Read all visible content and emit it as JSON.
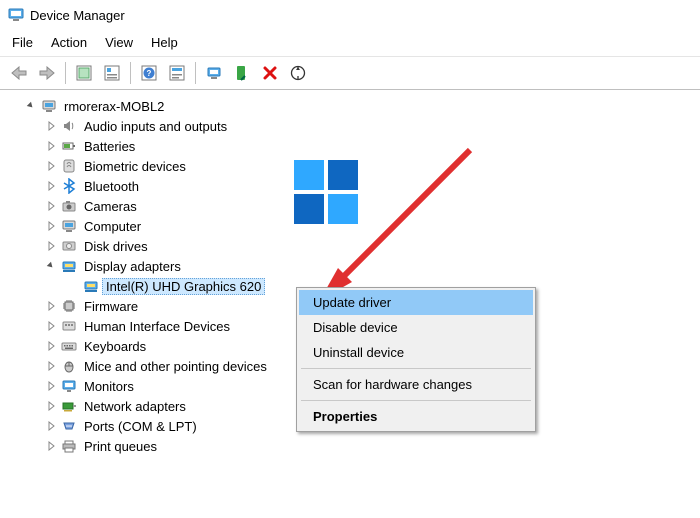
{
  "window": {
    "title": "Device Manager"
  },
  "menubar": {
    "file": "File",
    "action": "Action",
    "view": "View",
    "help": "Help"
  },
  "tree": {
    "root": "rmorerax-MOBL2",
    "nodes": {
      "audio": "Audio inputs and outputs",
      "batt": "Batteries",
      "bio": "Biometric devices",
      "bt": "Bluetooth",
      "cam": "Cameras",
      "comp": "Computer",
      "disk": "Disk drives",
      "disp": "Display adapters",
      "gpu": "Intel(R) UHD Graphics 620",
      "fw": "Firmware",
      "hid": "Human Interface Devices",
      "kb": "Keyboards",
      "mouse": "Mice and other pointing devices",
      "mon": "Monitors",
      "net": "Network adapters",
      "ports": "Ports (COM & LPT)",
      "prnq": "Print queues"
    }
  },
  "context": {
    "update": "Update driver",
    "disable": "Disable device",
    "uninst": "Uninstall device",
    "scan": "Scan for hardware changes",
    "props": "Properties"
  }
}
